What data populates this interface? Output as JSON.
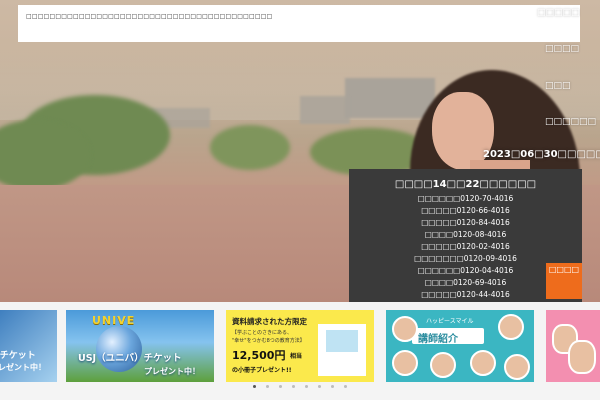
{
  "notice": {
    "text": "□□□□□□□□□□□□□□□□□□□□□□□□□□□□□□□□□□□□□□□□□□"
  },
  "nav": {
    "items": [
      "□□□□□",
      "□□□□",
      "□□□",
      "□□□□□□"
    ]
  },
  "date_banner": "2023□06□30□□□□□□",
  "phone_panel": {
    "title": "□□□□14□□22□□□□□□",
    "rows": [
      "□□□□□□0120-70-4016",
      "□□□□□0120-66-4016",
      "□□□□□0120-84-4016",
      "□□□□0120-08-4016",
      "□□□□□0120-02-4016",
      "□□□□□□□0120-09-4016",
      "□□□□□□0120-04-4016",
      "□□□□0120-69-4016",
      "□□□□□0120-44-4016"
    ],
    "button_label": "□□□□"
  },
  "banners": {
    "b1": {
      "line1": "-チケット",
      "line2": "レゼント中！"
    },
    "b2": {
      "arc": "UNIVE",
      "line1": "USJ（ユニバ）チケット",
      "line2": "プレゼント中！"
    },
    "b3": {
      "title": "資料請求された方限定",
      "line1": "【学ぶことのさきにある、",
      "line2": "\"幸せ\"をつかむ8つの教育方法】",
      "price": "12,500円",
      "suffix": "相当",
      "line3": "の小冊子プレゼント!!"
    },
    "b4": {
      "sub": "ハッピースマイル",
      "title": "講師紹介"
    },
    "b5": {
      "text": ""
    }
  },
  "pager": {
    "count": 8,
    "active": 0
  }
}
